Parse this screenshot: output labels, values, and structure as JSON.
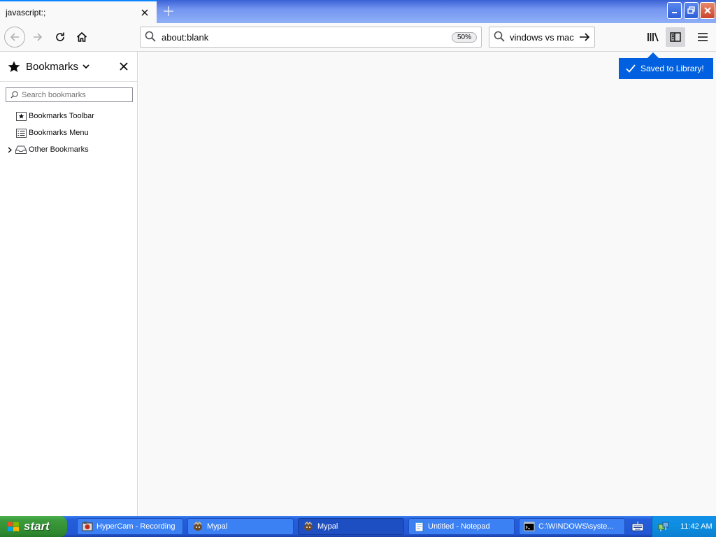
{
  "browser": {
    "tab": {
      "title": "javascript:;"
    },
    "urlbar": {
      "url": "about:blank",
      "zoom": "50%"
    },
    "searchbar": {
      "query": "vindows vs mac"
    }
  },
  "sidebar": {
    "title": "Bookmarks",
    "search_placeholder": "Search bookmarks",
    "items": [
      {
        "label": "Bookmarks Toolbar",
        "icon": "bookmarks-toolbar-icon",
        "expandable": false
      },
      {
        "label": "Bookmarks Menu",
        "icon": "bookmarks-menu-icon",
        "expandable": false
      },
      {
        "label": "Other Bookmarks",
        "icon": "other-bookmarks-icon",
        "expandable": true
      }
    ]
  },
  "toast": {
    "text": "Saved to Library!",
    "color": "#0060df"
  },
  "taskbar": {
    "start_label": "start",
    "tasks": [
      {
        "label": "HyperCam - Recording",
        "icon": "hypercam-icon",
        "active": false
      },
      {
        "label": "Mypal",
        "icon": "mypal-icon",
        "active": false
      },
      {
        "label": "Mypal",
        "icon": "mypal-icon",
        "active": true
      },
      {
        "label": "Untitled - Notepad",
        "icon": "notepad-icon",
        "active": false
      },
      {
        "label": "C:\\WINDOWS\\syste...",
        "icon": "cmd-icon",
        "active": false
      }
    ],
    "clock": "11:42 AM"
  },
  "colors": {
    "accent": "#0a84ff",
    "toast": "#0060df",
    "taskbar": "#245edb",
    "start": "#3c9a3c"
  }
}
